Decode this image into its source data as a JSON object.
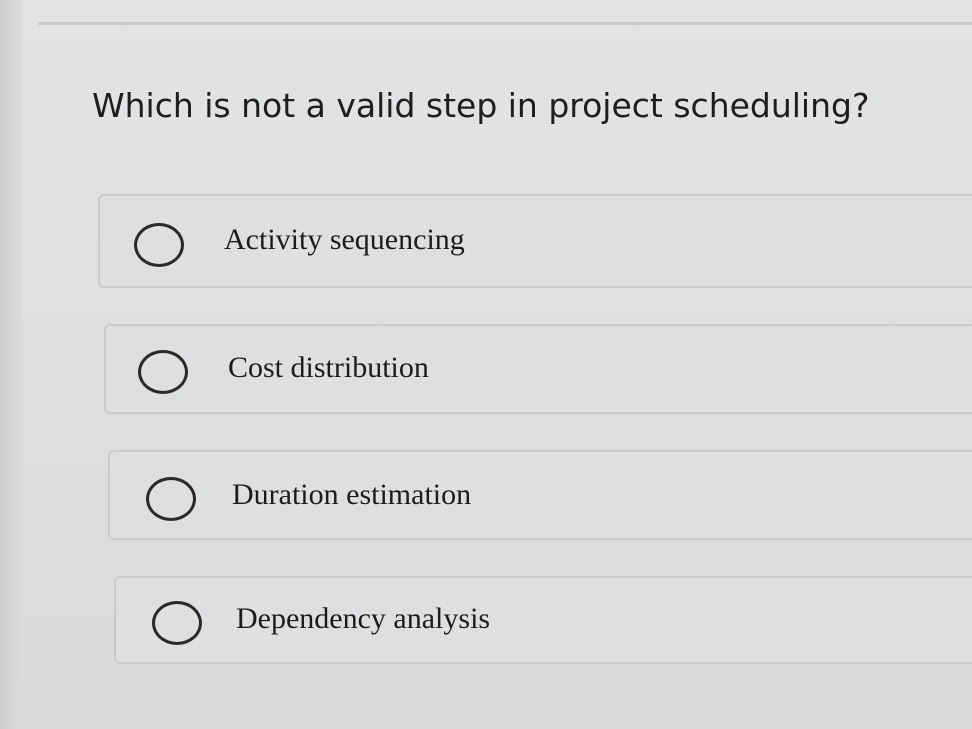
{
  "quiz": {
    "question": "Which is not a valid step in project scheduling?",
    "options": [
      {
        "label": "Activity sequencing",
        "selected": false
      },
      {
        "label": "Cost distribution",
        "selected": false
      },
      {
        "label": "Duration estimation",
        "selected": false
      },
      {
        "label": "Dependency analysis",
        "selected": false
      }
    ]
  },
  "colors": {
    "background": "#e0e1e2",
    "text": "#1e1e1e",
    "option_border": "#cacbcc"
  }
}
